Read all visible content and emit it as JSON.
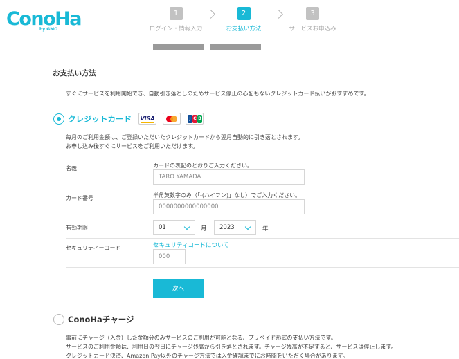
{
  "header": {
    "logo": "ConoHa",
    "logo_sub": "by GMO",
    "steps": [
      {
        "num": "1",
        "label": "ログイン・情報入力"
      },
      {
        "num": "2",
        "label": "お支払い方法"
      },
      {
        "num": "3",
        "label": "サービスお申込み"
      }
    ]
  },
  "main": {
    "title": "お支払い方法",
    "note": "すぐにサービスを利用開始でき、自動引き落としのためサービス停止の心配もないクレジットカード払いがおすすめです。",
    "credit": {
      "label": "クレジットカード",
      "cards": [
        "VISA",
        "MasterCard",
        "JCB"
      ],
      "desc1": "毎月のご利用金額は、ご登録いただいたクレジットカードから翌月自動的に引き落とされます。",
      "desc2": "お申し込み後すぐにサービスをご利用いただけます。",
      "name": {
        "label": "名義",
        "hint": "カードの表記のとおりご入力ください。",
        "placeholder": "TARO YAMADA"
      },
      "number": {
        "label": "カード番号",
        "hint": "半角英数字のみ（「-(ハイフン)」なし）でご入力ください。",
        "placeholder": "0000000000000000"
      },
      "expiry": {
        "label": "有効期限",
        "month": "01",
        "month_unit": "月",
        "year": "2023",
        "year_unit": "年"
      },
      "security": {
        "label": "セキュリティーコード",
        "link": "セキュリティコードについて",
        "placeholder": "000"
      },
      "next_button": "次へ"
    },
    "charge": {
      "label": "ConoHaチャージ",
      "desc1": "事前にチャージ（入金）した金額分のみサービスのご利用が可能となる、プリペイド形式の支払い方法です。",
      "desc2": "サービスのご利用金額は、利用日の翌日にチャージ残高から引き落とされます。チャージ残高が不足すると、サービスは停止します。",
      "desc3": "クレジットカード決済、Amazon Pay以外のチャージ方法では入金確認までにお時間をいただく場合があります。"
    }
  },
  "colors": {
    "accent": "#19b9d6",
    "inactive": "#c2c2c2"
  }
}
